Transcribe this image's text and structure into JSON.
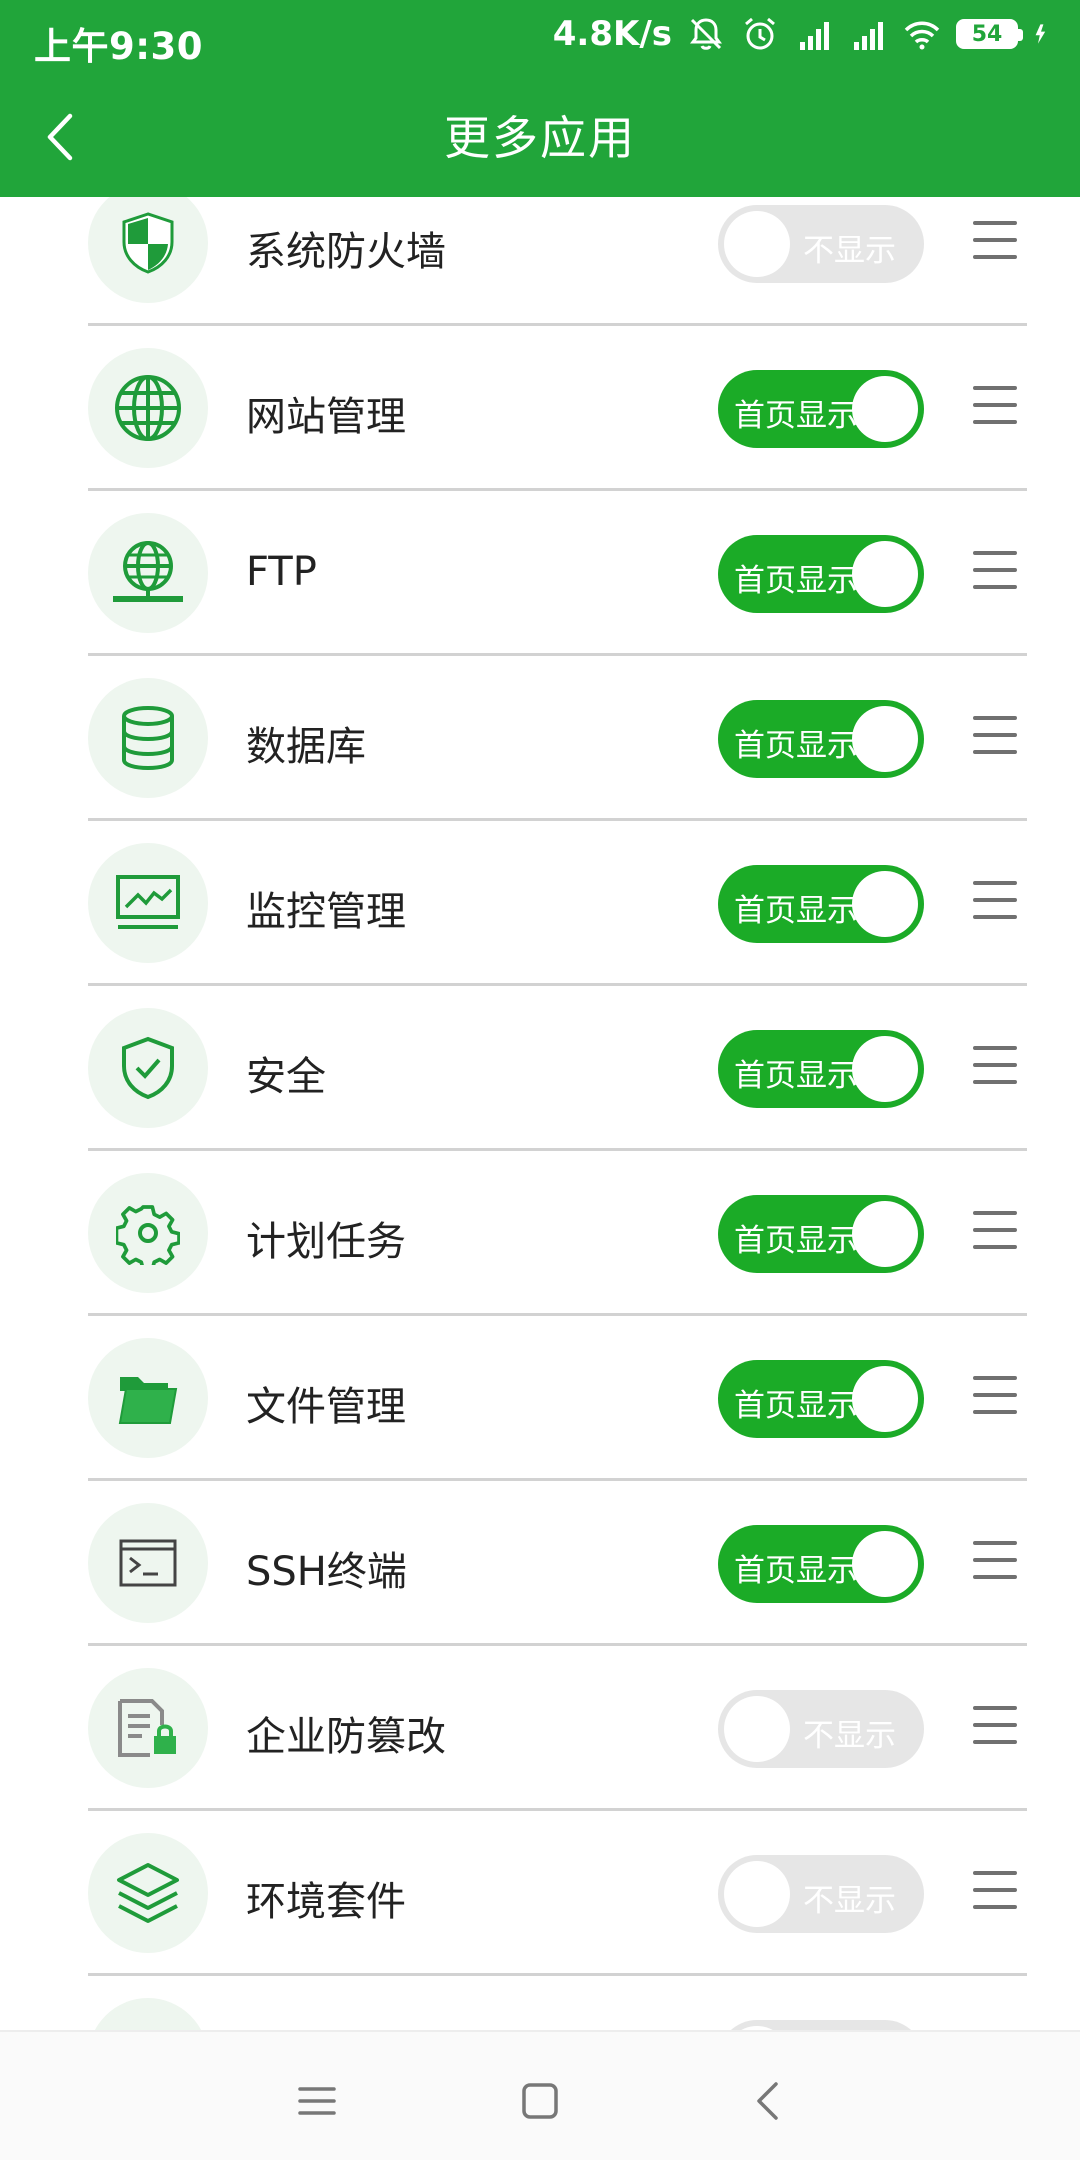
{
  "status_bar": {
    "time": "上午9:30",
    "net_speed": "4.8K/s",
    "battery": "54"
  },
  "header": {
    "title": "更多应用"
  },
  "colors": {
    "primary": "#21a53a",
    "toggle_on": "#1bab27",
    "toggle_off": "#e6e6e6",
    "icon_bg": "#eef6ef"
  },
  "items": [
    {
      "label": "系统防火墙",
      "icon": "firewall-shield-icon",
      "toggle": "不显示",
      "enabled": false
    },
    {
      "label": "网站管理",
      "icon": "globe-icon",
      "toggle": "首页显示",
      "enabled": true
    },
    {
      "label": "FTP",
      "icon": "ftp-globe-icon",
      "toggle": "首页显示",
      "enabled": true
    },
    {
      "label": "数据库",
      "icon": "database-icon",
      "toggle": "首页显示",
      "enabled": true
    },
    {
      "label": "监控管理",
      "icon": "monitor-chart-icon",
      "toggle": "首页显示",
      "enabled": true
    },
    {
      "label": "安全",
      "icon": "shield-check-icon",
      "toggle": "首页显示",
      "enabled": true
    },
    {
      "label": "计划任务",
      "icon": "gear-icon",
      "toggle": "首页显示",
      "enabled": true
    },
    {
      "label": "文件管理",
      "icon": "folder-icon",
      "toggle": "首页显示",
      "enabled": true
    },
    {
      "label": "SSH终端",
      "icon": "terminal-icon",
      "toggle": "首页显示",
      "enabled": true
    },
    {
      "label": "企业防篡改",
      "icon": "document-lock-icon",
      "toggle": "不显示",
      "enabled": false
    },
    {
      "label": "环境套件",
      "icon": "layers-icon",
      "toggle": "不显示",
      "enabled": false
    }
  ]
}
